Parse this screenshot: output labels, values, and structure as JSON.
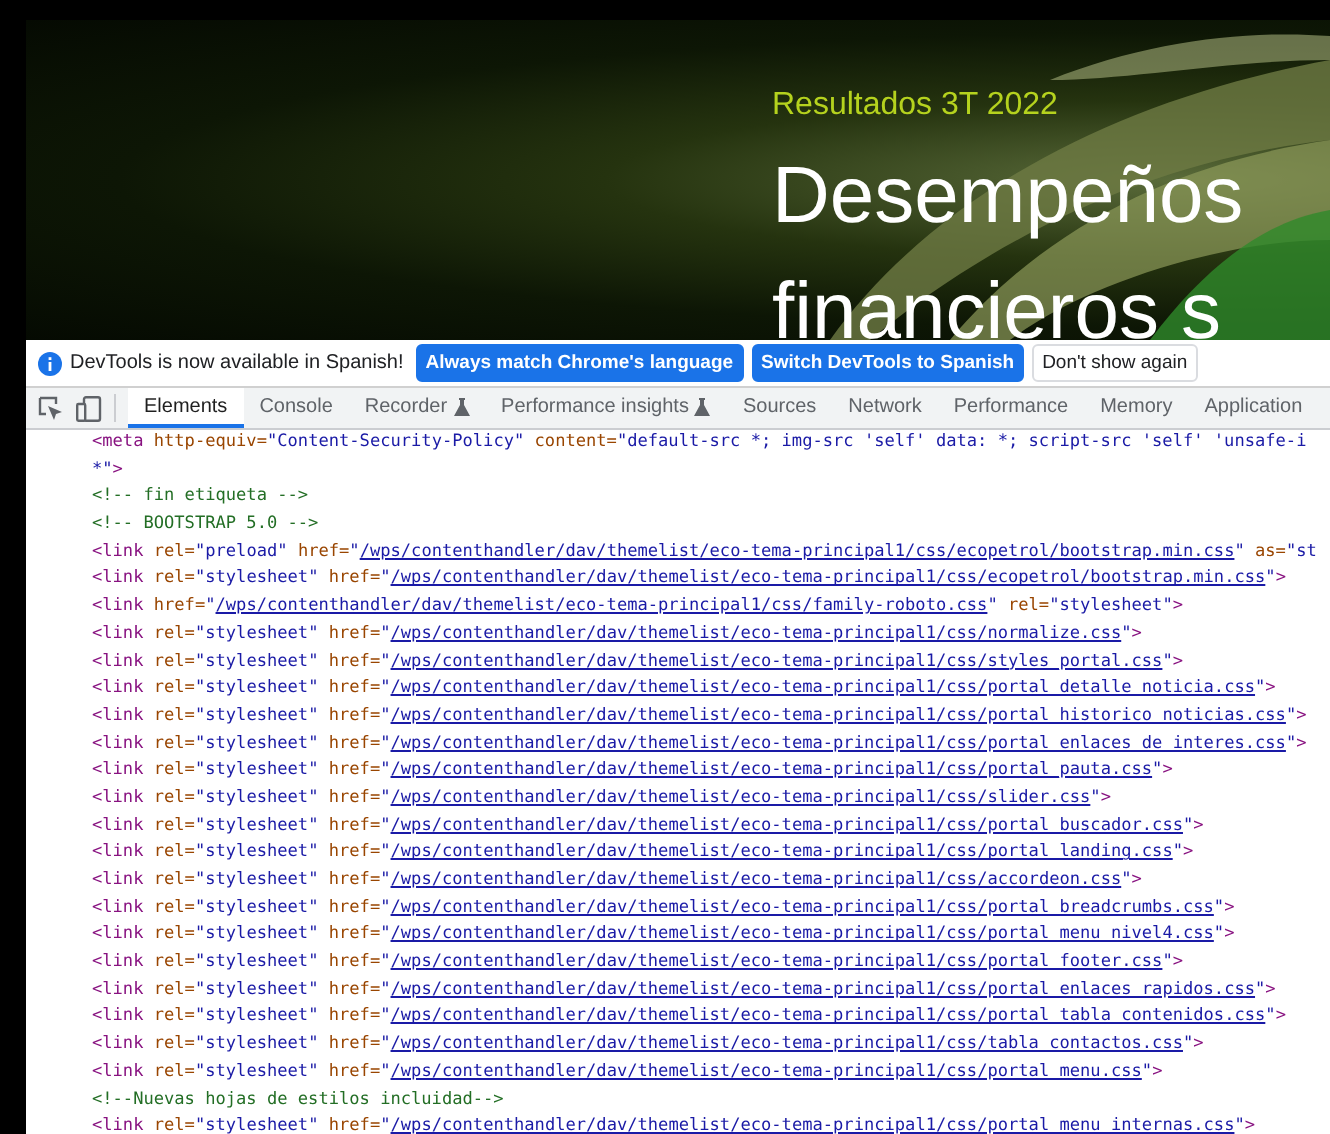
{
  "hero": {
    "eyebrow": "Resultados 3T 2022",
    "headline_lines": [
      "Desempeños",
      "financieros s"
    ]
  },
  "infobar": {
    "message": "DevTools is now available in Spanish!",
    "buttons": [
      {
        "label": "Always match Chrome's language",
        "kind": "primary"
      },
      {
        "label": "Switch DevTools to Spanish",
        "kind": "primary"
      },
      {
        "label": "Don't show again",
        "kind": "secondary"
      }
    ]
  },
  "tabs": [
    {
      "label": "Elements",
      "selected": true,
      "experimental": false
    },
    {
      "label": "Console",
      "selected": false,
      "experimental": false
    },
    {
      "label": "Recorder",
      "selected": false,
      "experimental": true
    },
    {
      "label": "Performance insights",
      "selected": false,
      "experimental": true
    },
    {
      "label": "Sources",
      "selected": false,
      "experimental": false
    },
    {
      "label": "Network",
      "selected": false,
      "experimental": false
    },
    {
      "label": "Performance",
      "selected": false,
      "experimental": false
    },
    {
      "label": "Memory",
      "selected": false,
      "experimental": false
    },
    {
      "label": "Application",
      "selected": false,
      "experimental": false
    }
  ],
  "code_lines": [
    [
      {
        "kind": "tag",
        "text": "<meta "
      },
      {
        "kind": "attr",
        "text": "http-equiv="
      },
      {
        "kind": "value",
        "text": "\"Content-Security-Policy\" "
      },
      {
        "kind": "attr",
        "text": "content="
      },
      {
        "kind": "value",
        "text": "\"default-src *; img-src 'self' data: *; script-src 'self' 'unsafe-i"
      }
    ],
    [
      {
        "kind": "value",
        "text": "*\""
      },
      {
        "kind": "tag",
        "text": ">"
      }
    ],
    [
      {
        "kind": "comment",
        "text": "<!-- fin etiqueta -->"
      }
    ],
    [
      {
        "kind": "comment",
        "text": "<!-- BOOTSTRAP 5.0 -->"
      }
    ],
    [
      {
        "kind": "tag",
        "text": "<link "
      },
      {
        "kind": "attr",
        "text": "rel="
      },
      {
        "kind": "value",
        "text": "\"preload\" "
      },
      {
        "kind": "attr",
        "text": "href="
      },
      {
        "kind": "value",
        "text": "\""
      },
      {
        "kind": "link",
        "text": "/wps/contenthandler/dav/themelist/eco-tema-principal1/css/ecopetrol/bootstrap.min.css"
      },
      {
        "kind": "value",
        "text": "\" "
      },
      {
        "kind": "attr",
        "text": "as="
      },
      {
        "kind": "value",
        "text": "\"st"
      }
    ],
    [
      {
        "kind": "tag",
        "text": "<link "
      },
      {
        "kind": "attr",
        "text": "rel="
      },
      {
        "kind": "value",
        "text": "\"stylesheet\" "
      },
      {
        "kind": "attr",
        "text": "href="
      },
      {
        "kind": "value",
        "text": "\""
      },
      {
        "kind": "link",
        "text": "/wps/contenthandler/dav/themelist/eco-tema-principal1/css/ecopetrol/bootstrap.min.css"
      },
      {
        "kind": "value",
        "text": "\""
      },
      {
        "kind": "tag",
        "text": ">"
      }
    ],
    [
      {
        "kind": "tag",
        "text": "<link "
      },
      {
        "kind": "attr",
        "text": "href="
      },
      {
        "kind": "value",
        "text": "\""
      },
      {
        "kind": "link",
        "text": "/wps/contenthandler/dav/themelist/eco-tema-principal1/css/family-roboto.css"
      },
      {
        "kind": "value",
        "text": "\" "
      },
      {
        "kind": "attr",
        "text": "rel="
      },
      {
        "kind": "value",
        "text": "\"stylesheet\""
      },
      {
        "kind": "tag",
        "text": ">"
      }
    ],
    [
      {
        "kind": "tag",
        "text": "<link "
      },
      {
        "kind": "attr",
        "text": "rel="
      },
      {
        "kind": "value",
        "text": "\"stylesheet\" "
      },
      {
        "kind": "attr",
        "text": "href="
      },
      {
        "kind": "value",
        "text": "\""
      },
      {
        "kind": "link",
        "text": "/wps/contenthandler/dav/themelist/eco-tema-principal1/css/normalize.css"
      },
      {
        "kind": "value",
        "text": "\""
      },
      {
        "kind": "tag",
        "text": ">"
      }
    ],
    [
      {
        "kind": "tag",
        "text": "<link "
      },
      {
        "kind": "attr",
        "text": "rel="
      },
      {
        "kind": "value",
        "text": "\"stylesheet\" "
      },
      {
        "kind": "attr",
        "text": "href="
      },
      {
        "kind": "value",
        "text": "\""
      },
      {
        "kind": "link",
        "text": "/wps/contenthandler/dav/themelist/eco-tema-principal1/css/styles_portal.css"
      },
      {
        "kind": "value",
        "text": "\""
      },
      {
        "kind": "tag",
        "text": ">"
      }
    ],
    [
      {
        "kind": "tag",
        "text": "<link "
      },
      {
        "kind": "attr",
        "text": "rel="
      },
      {
        "kind": "value",
        "text": "\"stylesheet\" "
      },
      {
        "kind": "attr",
        "text": "href="
      },
      {
        "kind": "value",
        "text": "\""
      },
      {
        "kind": "link",
        "text": "/wps/contenthandler/dav/themelist/eco-tema-principal1/css/portal_detalle_noticia.css"
      },
      {
        "kind": "value",
        "text": "\""
      },
      {
        "kind": "tag",
        "text": ">"
      }
    ],
    [
      {
        "kind": "tag",
        "text": "<link "
      },
      {
        "kind": "attr",
        "text": "rel="
      },
      {
        "kind": "value",
        "text": "\"stylesheet\" "
      },
      {
        "kind": "attr",
        "text": "href="
      },
      {
        "kind": "value",
        "text": "\""
      },
      {
        "kind": "link",
        "text": "/wps/contenthandler/dav/themelist/eco-tema-principal1/css/portal_historico_noticias.css"
      },
      {
        "kind": "value",
        "text": "\""
      },
      {
        "kind": "tag",
        "text": ">"
      }
    ],
    [
      {
        "kind": "tag",
        "text": "<link "
      },
      {
        "kind": "attr",
        "text": "rel="
      },
      {
        "kind": "value",
        "text": "\"stylesheet\" "
      },
      {
        "kind": "attr",
        "text": "href="
      },
      {
        "kind": "value",
        "text": "\""
      },
      {
        "kind": "link",
        "text": "/wps/contenthandler/dav/themelist/eco-tema-principal1/css/portal_enlaces_de_interes.css"
      },
      {
        "kind": "value",
        "text": "\""
      },
      {
        "kind": "tag",
        "text": ">"
      }
    ],
    [
      {
        "kind": "tag",
        "text": "<link "
      },
      {
        "kind": "attr",
        "text": "rel="
      },
      {
        "kind": "value",
        "text": "\"stylesheet\" "
      },
      {
        "kind": "attr",
        "text": "href="
      },
      {
        "kind": "value",
        "text": "\""
      },
      {
        "kind": "link",
        "text": "/wps/contenthandler/dav/themelist/eco-tema-principal1/css/portal_pauta.css"
      },
      {
        "kind": "value",
        "text": "\""
      },
      {
        "kind": "tag",
        "text": ">"
      }
    ],
    [
      {
        "kind": "tag",
        "text": "<link "
      },
      {
        "kind": "attr",
        "text": "rel="
      },
      {
        "kind": "value",
        "text": "\"stylesheet\" "
      },
      {
        "kind": "attr",
        "text": "href="
      },
      {
        "kind": "value",
        "text": "\""
      },
      {
        "kind": "link",
        "text": "/wps/contenthandler/dav/themelist/eco-tema-principal1/css/slider.css"
      },
      {
        "kind": "value",
        "text": "\""
      },
      {
        "kind": "tag",
        "text": ">"
      }
    ],
    [
      {
        "kind": "tag",
        "text": "<link "
      },
      {
        "kind": "attr",
        "text": "rel="
      },
      {
        "kind": "value",
        "text": "\"stylesheet\" "
      },
      {
        "kind": "attr",
        "text": "href="
      },
      {
        "kind": "value",
        "text": "\""
      },
      {
        "kind": "link",
        "text": "/wps/contenthandler/dav/themelist/eco-tema-principal1/css/portal_buscador.css"
      },
      {
        "kind": "value",
        "text": "\""
      },
      {
        "kind": "tag",
        "text": ">"
      }
    ],
    [
      {
        "kind": "tag",
        "text": "<link "
      },
      {
        "kind": "attr",
        "text": "rel="
      },
      {
        "kind": "value",
        "text": "\"stylesheet\" "
      },
      {
        "kind": "attr",
        "text": "href="
      },
      {
        "kind": "value",
        "text": "\""
      },
      {
        "kind": "link",
        "text": "/wps/contenthandler/dav/themelist/eco-tema-principal1/css/portal_landing.css"
      },
      {
        "kind": "value",
        "text": "\""
      },
      {
        "kind": "tag",
        "text": ">"
      }
    ],
    [
      {
        "kind": "tag",
        "text": "<link "
      },
      {
        "kind": "attr",
        "text": "rel="
      },
      {
        "kind": "value",
        "text": "\"stylesheet\" "
      },
      {
        "kind": "attr",
        "text": "href="
      },
      {
        "kind": "value",
        "text": "\""
      },
      {
        "kind": "link",
        "text": "/wps/contenthandler/dav/themelist/eco-tema-principal1/css/accordeon.css"
      },
      {
        "kind": "value",
        "text": "\""
      },
      {
        "kind": "tag",
        "text": ">"
      }
    ],
    [
      {
        "kind": "tag",
        "text": "<link "
      },
      {
        "kind": "attr",
        "text": "rel="
      },
      {
        "kind": "value",
        "text": "\"stylesheet\" "
      },
      {
        "kind": "attr",
        "text": "href="
      },
      {
        "kind": "value",
        "text": "\""
      },
      {
        "kind": "link",
        "text": "/wps/contenthandler/dav/themelist/eco-tema-principal1/css/portal_breadcrumbs.css"
      },
      {
        "kind": "value",
        "text": "\""
      },
      {
        "kind": "tag",
        "text": ">"
      }
    ],
    [
      {
        "kind": "tag",
        "text": "<link "
      },
      {
        "kind": "attr",
        "text": "rel="
      },
      {
        "kind": "value",
        "text": "\"stylesheet\" "
      },
      {
        "kind": "attr",
        "text": "href="
      },
      {
        "kind": "value",
        "text": "\""
      },
      {
        "kind": "link",
        "text": "/wps/contenthandler/dav/themelist/eco-tema-principal1/css/portal_menu_nivel4.css"
      },
      {
        "kind": "value",
        "text": "\""
      },
      {
        "kind": "tag",
        "text": ">"
      }
    ],
    [
      {
        "kind": "tag",
        "text": "<link "
      },
      {
        "kind": "attr",
        "text": "rel="
      },
      {
        "kind": "value",
        "text": "\"stylesheet\" "
      },
      {
        "kind": "attr",
        "text": "href="
      },
      {
        "kind": "value",
        "text": "\""
      },
      {
        "kind": "link",
        "text": "/wps/contenthandler/dav/themelist/eco-tema-principal1/css/portal_footer.css"
      },
      {
        "kind": "value",
        "text": "\""
      },
      {
        "kind": "tag",
        "text": ">"
      }
    ],
    [
      {
        "kind": "tag",
        "text": "<link "
      },
      {
        "kind": "attr",
        "text": "rel="
      },
      {
        "kind": "value",
        "text": "\"stylesheet\" "
      },
      {
        "kind": "attr",
        "text": "href="
      },
      {
        "kind": "value",
        "text": "\""
      },
      {
        "kind": "link",
        "text": "/wps/contenthandler/dav/themelist/eco-tema-principal1/css/portal_enlaces_rapidos.css"
      },
      {
        "kind": "value",
        "text": "\""
      },
      {
        "kind": "tag",
        "text": ">"
      }
    ],
    [
      {
        "kind": "tag",
        "text": "<link "
      },
      {
        "kind": "attr",
        "text": "rel="
      },
      {
        "kind": "value",
        "text": "\"stylesheet\" "
      },
      {
        "kind": "attr",
        "text": "href="
      },
      {
        "kind": "value",
        "text": "\""
      },
      {
        "kind": "link",
        "text": "/wps/contenthandler/dav/themelist/eco-tema-principal1/css/portal_tabla_contenidos.css"
      },
      {
        "kind": "value",
        "text": "\""
      },
      {
        "kind": "tag",
        "text": ">"
      }
    ],
    [
      {
        "kind": "tag",
        "text": "<link "
      },
      {
        "kind": "attr",
        "text": "rel="
      },
      {
        "kind": "value",
        "text": "\"stylesheet\" "
      },
      {
        "kind": "attr",
        "text": "href="
      },
      {
        "kind": "value",
        "text": "\""
      },
      {
        "kind": "link",
        "text": "/wps/contenthandler/dav/themelist/eco-tema-principal1/css/tabla_contactos.css"
      },
      {
        "kind": "value",
        "text": "\""
      },
      {
        "kind": "tag",
        "text": ">"
      }
    ],
    [
      {
        "kind": "tag",
        "text": "<link "
      },
      {
        "kind": "attr",
        "text": "rel="
      },
      {
        "kind": "value",
        "text": "\"stylesheet\" "
      },
      {
        "kind": "attr",
        "text": "href="
      },
      {
        "kind": "value",
        "text": "\""
      },
      {
        "kind": "link",
        "text": "/wps/contenthandler/dav/themelist/eco-tema-principal1/css/portal_menu.css"
      },
      {
        "kind": "value",
        "text": "\""
      },
      {
        "kind": "tag",
        "text": ">"
      }
    ],
    [
      {
        "kind": "comment",
        "text": "<!--Nuevas hojas de estilos incluidad-->"
      }
    ],
    [
      {
        "kind": "tag",
        "text": "<link "
      },
      {
        "kind": "attr",
        "text": "rel="
      },
      {
        "kind": "value",
        "text": "\"stylesheet\" "
      },
      {
        "kind": "attr",
        "text": "href="
      },
      {
        "kind": "value",
        "text": "\""
      },
      {
        "kind": "link",
        "text": "/wps/contenthandler/dav/themelist/eco-tema-principal1/css/portal_menu_internas.css"
      },
      {
        "kind": "value",
        "text": "\""
      },
      {
        "kind": "tag",
        "text": ">"
      }
    ]
  ]
}
